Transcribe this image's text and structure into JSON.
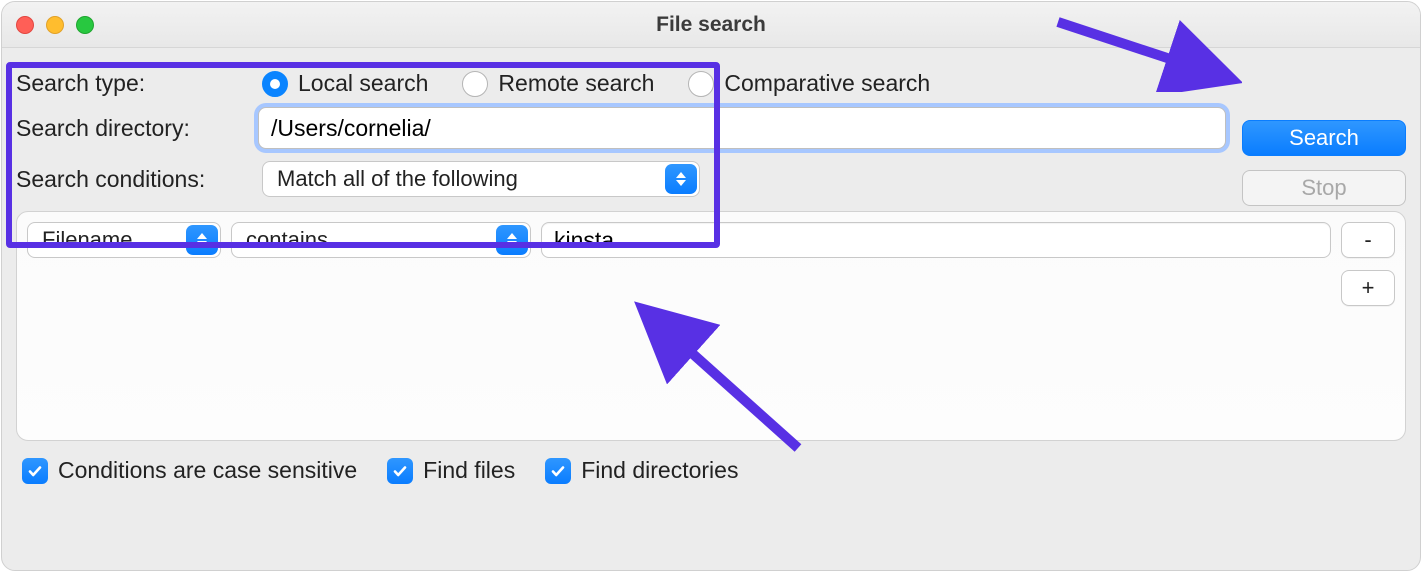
{
  "window_title": "File search",
  "labels": {
    "search_type": "Search type:",
    "search_directory": "Search directory:",
    "search_conditions": "Search conditions:"
  },
  "search_type_options": {
    "local": "Local search",
    "remote": "Remote search",
    "comparative": "Comparative search"
  },
  "search_type_selected": "local",
  "directory_value": "/Users/cornelia/",
  "conditions_select": "Match all of the following",
  "buttons": {
    "search": "Search",
    "stop": "Stop",
    "remove": "-",
    "add": "+"
  },
  "condition_row": {
    "field": "Filename",
    "operator": "contains",
    "value": "kinsta"
  },
  "checkboxes": {
    "case_sensitive": "Conditions are case sensitive",
    "find_files": "Find files",
    "find_dirs": "Find directories"
  },
  "colors": {
    "annotation": "#5830e4",
    "accent": "#0a84ff"
  }
}
